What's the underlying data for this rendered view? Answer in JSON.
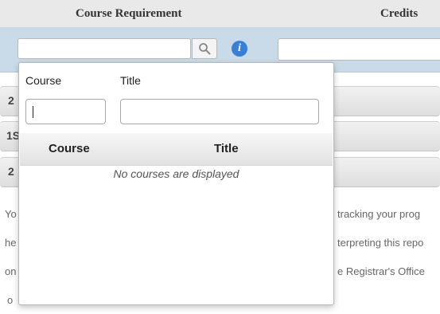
{
  "header": {
    "col_requirement": "Course Requirement",
    "col_credits": "Credits"
  },
  "search": {
    "course_value": "",
    "search_icon": "magnifier-icon",
    "info_icon": "info-icon",
    "info_glyph": "i",
    "credits_value": ""
  },
  "background": {
    "row_fragments": [
      "2",
      "1S",
      "2"
    ],
    "text_left": [
      "Yo",
      "he",
      "on",
      "o"
    ],
    "text_right": [
      "tracking your prog",
      "terpreting this repo",
      "e Registrar's Office"
    ]
  },
  "popup": {
    "filter_labels": {
      "course": "Course",
      "title": "Title"
    },
    "course_filter_value": "",
    "title_filter_value": "",
    "results_columns": [
      "Course",
      "Title"
    ],
    "empty_message": "No courses are displayed"
  },
  "colors": {
    "strip": "#c9dbe8",
    "info": "#3a7fd6"
  }
}
